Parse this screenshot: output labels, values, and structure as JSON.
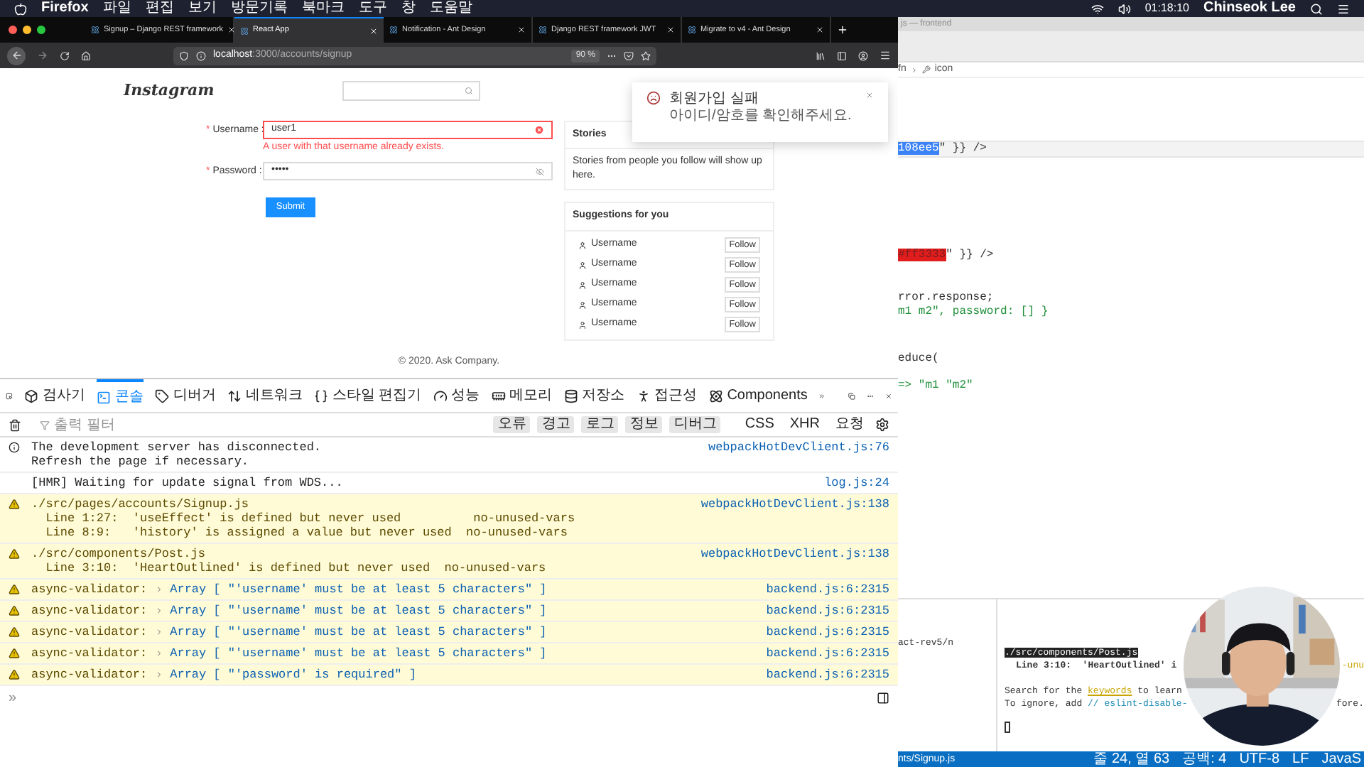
{
  "menu_bar": {
    "app": "Firefox",
    "items": [
      "파일",
      "편집",
      "보기",
      "방문기록",
      "북마크",
      "도구",
      "창",
      "도움말"
    ],
    "time": "01:18:10",
    "user": "Chinseok Lee"
  },
  "browser": {
    "tabs": [
      {
        "label": "Signup – Django REST framework",
        "selected": false
      },
      {
        "label": "React App",
        "selected": true
      },
      {
        "label": "Notification - Ant Design",
        "selected": false
      },
      {
        "label": "Django REST framework JWT",
        "selected": false
      },
      {
        "label": "Migrate to v4 - Ant Design",
        "selected": false
      }
    ],
    "url_host": "localhost",
    "url_path": ":3000/accounts/signup",
    "zoom": "90 %"
  },
  "page": {
    "logo": "Instagram",
    "form": {
      "fields": [
        {
          "required_mark": "*",
          "label": "Username :",
          "value": "user1",
          "kind": "text",
          "error": "A user with that username already exists."
        },
        {
          "required_mark": "*",
          "label": "Password :",
          "value": "•••••",
          "kind": "password"
        }
      ],
      "submit": "Submit"
    },
    "stories": {
      "title": "Stories",
      "body": "Stories from people you follow will show up here."
    },
    "suggestions": {
      "title": "Suggestions for you",
      "items": [
        {
          "name": "Username",
          "action": "Follow"
        },
        {
          "name": "Username",
          "action": "Follow"
        },
        {
          "name": "Username",
          "action": "Follow"
        },
        {
          "name": "Username",
          "action": "Follow"
        },
        {
          "name": "Username",
          "action": "Follow"
        }
      ]
    },
    "footer": "© 2020. Ask Company.",
    "notification": {
      "title": "회원가입 실패",
      "description": "아이디/암호를 확인해주세요."
    }
  },
  "devtools": {
    "tabs": [
      {
        "label": "검사기",
        "selected": false
      },
      {
        "label": "콘솔",
        "selected": true
      },
      {
        "label": "디버거",
        "selected": false
      },
      {
        "label": "네트워크",
        "selected": false
      },
      {
        "label": "스타일 편집기",
        "selected": false
      },
      {
        "label": "성능",
        "selected": false
      },
      {
        "label": "메모리",
        "selected": false
      },
      {
        "label": "저장소",
        "selected": false
      },
      {
        "label": "접근성",
        "selected": false
      },
      {
        "label": "Components",
        "selected": false
      }
    ],
    "filter_placeholder": "출력 필터",
    "levels": [
      "오류",
      "경고",
      "로그",
      "정보",
      "디버그"
    ],
    "extra_filters": [
      "CSS",
      "XHR",
      "요청"
    ],
    "messages": [
      {
        "info": true,
        "warning": false,
        "kind": "text",
        "lines": [
          "The development server has disconnected.",
          "Refresh the page if necessary."
        ],
        "source": "webpackHotDevClient.js:76"
      },
      {
        "info": false,
        "warning": false,
        "kind": "text",
        "lines": [
          "[HMR] Waiting for update signal from WDS..."
        ],
        "source": "log.js:24"
      },
      {
        "info": false,
        "warning": true,
        "kind": "text",
        "lines": [
          "./src/pages/accounts/Signup.js",
          "  Line 1:27:  'useEffect' is defined but never used          no-unused-vars",
          "  Line 8:9:   'history' is assigned a value but never used  no-unused-vars"
        ],
        "source": "webpackHotDevClient.js:138"
      },
      {
        "info": false,
        "warning": true,
        "kind": "text",
        "lines": [
          "./src/components/Post.js",
          "  Line 3:10:  'HeartOutlined' is defined but never used  no-unused-vars"
        ],
        "source": "webpackHotDevClient.js:138"
      },
      {
        "info": false,
        "warning": true,
        "kind": "array",
        "prefix": "async-validator:",
        "label": "Array",
        "value": "[ \"'username' must be at least 5 characters\" ]",
        "source": "backend.js:6:2315"
      },
      {
        "info": false,
        "warning": true,
        "kind": "array",
        "prefix": "async-validator:",
        "label": "Array",
        "value": "[ \"'username' must be at least 5 characters\" ]",
        "source": "backend.js:6:2315"
      },
      {
        "info": false,
        "warning": true,
        "kind": "array",
        "prefix": "async-validator:",
        "label": "Array",
        "value": "[ \"'username' must be at least 5 characters\" ]",
        "source": "backend.js:6:2315"
      },
      {
        "info": false,
        "warning": true,
        "kind": "array",
        "prefix": "async-validator:",
        "label": "Array",
        "value": "[ \"'username' must be at least 5 characters\" ]",
        "source": "backend.js:6:2315"
      },
      {
        "info": false,
        "warning": true,
        "kind": "array",
        "prefix": "async-validator:",
        "label": "Array",
        "value": "[ \"'password' is required\" ]",
        "source": "backend.js:6:2315"
      }
    ],
    "prompt": "»"
  },
  "editor": {
    "title": "js — frontend",
    "breadcrumb": [
      "fn",
      "icon"
    ],
    "code_lines": [
      {
        "current": true,
        "segments": [
          {
            "kind": "selected",
            "text": "108ee5"
          },
          {
            "kind": "plain",
            "text": "\" }} />"
          }
        ]
      },
      {
        "current": false,
        "segments": [
          {
            "kind": "red",
            "text": "#ff3333"
          },
          {
            "kind": "plain",
            "text": "\" }} />"
          }
        ]
      },
      {
        "current": false,
        "segments": [
          {
            "kind": "plain",
            "text": "rror.response;"
          }
        ]
      },
      {
        "current": false,
        "segments": [
          {
            "kind": "green",
            "text": "m1 m2\", password: [] }"
          }
        ]
      },
      {
        "current": false,
        "segments": [
          {
            "kind": "plain",
            "text": "educe("
          }
        ]
      },
      {
        "current": false,
        "segments": [
          {
            "kind": "green",
            "text": "=> \"m1 \"m2\""
          }
        ]
      }
    ],
    "terminal": {
      "left": "act-rev5/n",
      "heading": "./src/components/Post.js",
      "line": "Line 3:10:  'HeartOutlined' i",
      "line_tail": "-unu",
      "search": [
        {
          "kind": "plain",
          "text": "Search for the "
        },
        {
          "kind": "link",
          "text": "keywords"
        },
        {
          "kind": "plain",
          "text": " to learn"
        }
      ],
      "ignore": [
        {
          "kind": "plain",
          "text": "To ignore, add "
        },
        {
          "kind": "code",
          "text": "// eslint-disable-"
        }
      ],
      "ignore_tail": "fore."
    },
    "status": {
      "file": "nts/Signup.js",
      "items": [
        "줄 24, 열 63",
        "공백: 4",
        "UTF-8",
        "LF",
        "JavaS"
      ]
    }
  }
}
